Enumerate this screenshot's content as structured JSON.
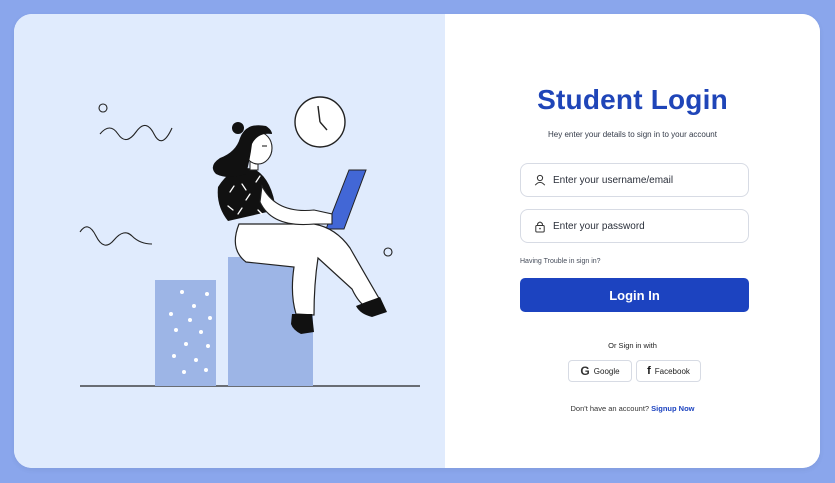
{
  "title": "Student Login",
  "subtitle": "Hey enter your details to sign in to your account",
  "username": {
    "placeholder": "Enter your username/email",
    "icon": "user-icon"
  },
  "password": {
    "placeholder": "Enter your password",
    "icon": "lock-icon"
  },
  "trouble_link": "Having Trouble in sign in?",
  "login_button": "Login In",
  "or_text": "Or Sign in with",
  "social": {
    "google": {
      "label": "Google",
      "glyph": "G"
    },
    "facebook": {
      "label": "Facebook",
      "glyph": "f"
    }
  },
  "signup": {
    "prompt": "Don't have an account?",
    "link": "Signup Now"
  },
  "colors": {
    "accent": "#1c43c0",
    "title": "#1f45b8",
    "panel": "#e0ebfd",
    "background": "#8aa6ec"
  }
}
